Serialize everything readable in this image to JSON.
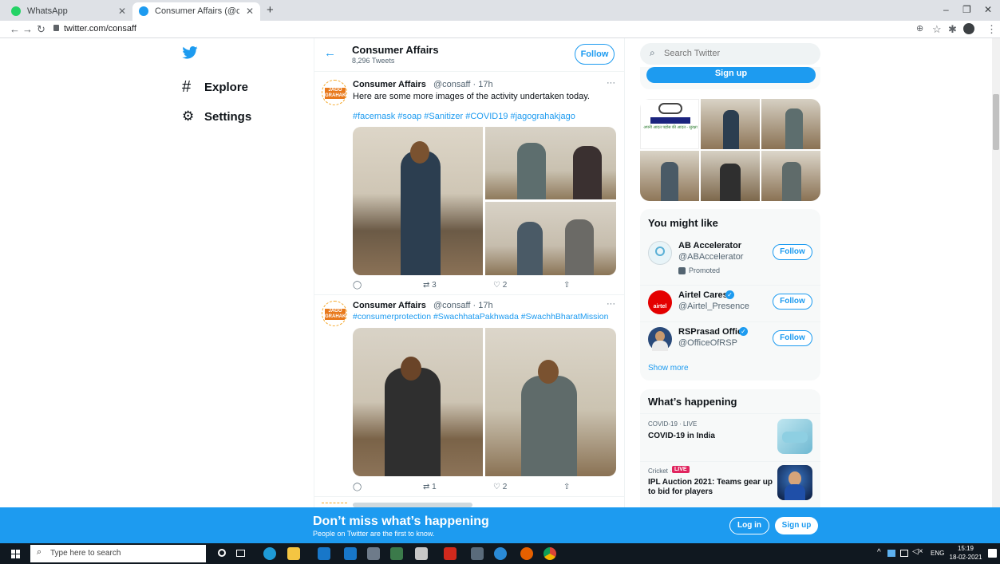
{
  "browser": {
    "tabs": [
      {
        "title": "WhatsApp",
        "active": false
      },
      {
        "title": "Consumer Affairs (@consaff) / Tw",
        "active": true
      }
    ],
    "new_tab": "+",
    "url": "twitter.com/consaff",
    "window_controls": [
      "–",
      "❐",
      "✕"
    ]
  },
  "left_nav": {
    "items": [
      {
        "label": "Explore",
        "icon": "hash-icon"
      },
      {
        "label": "Settings",
        "icon": "gear-icon"
      }
    ]
  },
  "profile_header": {
    "name": "Consumer Affairs",
    "tweet_count": "8,296 Tweets",
    "follow_label": "Follow"
  },
  "tweets": [
    {
      "name": "Consumer Affairs",
      "handle": "@consaff · 17h",
      "text": "Here are some more images of the activity undertaken today.",
      "hashtags": "#facemask #soap #Sanitizer #COVID19 #jagograhakjago",
      "replies": "",
      "retweets": "3",
      "likes": "2",
      "more": "···"
    },
    {
      "name": "Consumer Affairs",
      "handle": "@consaff · 17h",
      "text": "",
      "hashtags": "#consumerprotection #SwachhataPakhwada #SwachhBharatMission",
      "replies": "",
      "retweets": "1",
      "likes": "2",
      "more": "···"
    }
  ],
  "avatar_text": {
    "line1": "JAGO",
    "line2": "GRAHAK",
    "line3": "JAGO"
  },
  "search": {
    "placeholder": "Search Twitter"
  },
  "signup_button": "Sign up",
  "media_thumb_caption": "अपनी आदत पड़ोस की आदत - सुरक्षा",
  "you_might_like": {
    "title": "You might like",
    "accounts": [
      {
        "name": "AB Accelerator",
        "handle": "@ABAccelerator",
        "promoted": "Promoted",
        "follow": "Follow",
        "avatar_color": "#e8f4f8"
      },
      {
        "name": "Airtel Cares",
        "handle": "@Airtel_Presence",
        "follow": "Follow",
        "avatar_color": "#e40000",
        "avatar_text": "airtel"
      },
      {
        "name": "RSPrasad Office",
        "handle": "@OfficeOfRSP",
        "follow": "Follow",
        "avatar_color": "#2a4a7a"
      }
    ],
    "show_more": "Show more"
  },
  "whats_happening": {
    "title": "What’s happening",
    "items": [
      {
        "meta": "COVID-19 · LIVE",
        "title": "COVID-19 in India"
      },
      {
        "meta": "Cricket · ",
        "live_badge": "LIVE",
        "title": "IPL Auction 2021: Teams gear up to bid for players"
      }
    ]
  },
  "banner": {
    "title": "Don’t miss what’s happening",
    "subtitle": "People on Twitter are the first to know.",
    "login": "Log in",
    "signup": "Sign up"
  },
  "taskbar": {
    "search_placeholder": "Type here to search",
    "lang": "ENG",
    "time": "15:19",
    "date": "18-02-2021"
  },
  "colors": {
    "twitter_blue": "#1d9bf0",
    "taskbar": "#101820",
    "tab_strip": "#dee1e6"
  }
}
